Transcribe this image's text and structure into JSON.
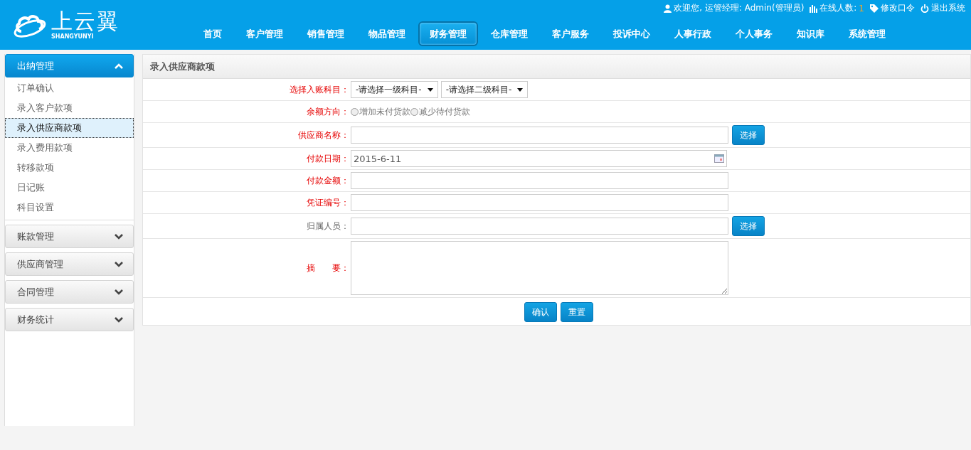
{
  "logo": {
    "name": "上云翼",
    "subtitle": "SHANGYUNYI"
  },
  "user_bar": {
    "welcome": "欢迎您, 运管经理: Admin(管理员)",
    "online_label": "在线人数:",
    "online_count": "1",
    "change_password": "修改口令",
    "logout": "退出系统"
  },
  "nav": [
    {
      "label": "首页",
      "selected": false
    },
    {
      "label": "客户管理",
      "selected": false
    },
    {
      "label": "销售管理",
      "selected": false
    },
    {
      "label": "物品管理",
      "selected": false
    },
    {
      "label": "财务管理",
      "selected": true
    },
    {
      "label": "仓库管理",
      "selected": false
    },
    {
      "label": "客户服务",
      "selected": false
    },
    {
      "label": "投诉中心",
      "selected": false
    },
    {
      "label": "人事行政",
      "selected": false
    },
    {
      "label": "个人事务",
      "selected": false
    },
    {
      "label": "知识库",
      "selected": false
    },
    {
      "label": "系统管理",
      "selected": false
    }
  ],
  "sidebar": [
    {
      "title": "出纳管理",
      "expanded": true,
      "items": [
        {
          "label": "订单确认",
          "selected": false
        },
        {
          "label": "录入客户款项",
          "selected": false
        },
        {
          "label": "录入供应商款项",
          "selected": true
        },
        {
          "label": "录入费用款项",
          "selected": false
        },
        {
          "label": "转移款项",
          "selected": false
        },
        {
          "label": "日记账",
          "selected": false
        },
        {
          "label": "科目设置",
          "selected": false
        }
      ]
    },
    {
      "title": "账款管理",
      "expanded": false
    },
    {
      "title": "供应商管理",
      "expanded": false
    },
    {
      "title": "合同管理",
      "expanded": false
    },
    {
      "title": "财务统计",
      "expanded": false
    }
  ],
  "form": {
    "title": "录入供应商款项",
    "rows": [
      {
        "kind": "selects",
        "label": "选择入账科目：",
        "required": true,
        "selects": [
          "-请选择一级科目-",
          "-请选择二级科目-"
        ]
      },
      {
        "kind": "radios",
        "label": "余额方向：",
        "required": true,
        "options": [
          {
            "label": "增加未付货款",
            "selected": false
          },
          {
            "label": "减少待付货款",
            "selected": false
          }
        ]
      },
      {
        "kind": "text",
        "label": "供应商名称：",
        "required": true,
        "button": "选择"
      },
      {
        "kind": "date",
        "label": "付款日期：",
        "required": true,
        "value": "2015-6-11"
      },
      {
        "kind": "text",
        "label": "付款金额：",
        "required": true
      },
      {
        "kind": "text",
        "label": "凭证编号：",
        "required": true
      },
      {
        "kind": "text",
        "label": "归属人员：",
        "required": false,
        "button": "选择"
      },
      {
        "kind": "textarea",
        "label": "摘　　要：",
        "required": true
      }
    ],
    "buttons": [
      "确认",
      "重置"
    ]
  }
}
